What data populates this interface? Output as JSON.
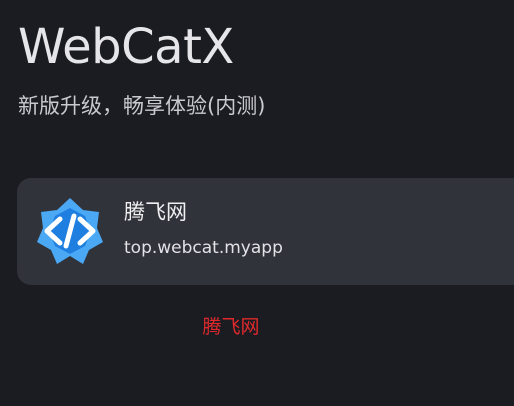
{
  "header": {
    "title": "WebCatX",
    "subtitle": "新版升级，畅享体验(内测)"
  },
  "app_card": {
    "name": "腾飞网",
    "package": "top.webcat.myapp",
    "icon": "code-brackets-hexagon-icon",
    "icon_colors": {
      "light": "#4aa8f5",
      "dark": "#1f7fe0",
      "glyph": "#ffffff"
    }
  },
  "footer": {
    "link_label": "腾飞网",
    "link_color": "#e0292c"
  },
  "colors": {
    "background": "#1b1c21",
    "card": "#31333a"
  }
}
